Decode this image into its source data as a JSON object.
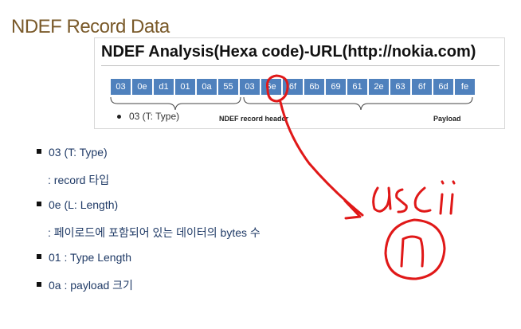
{
  "slide": {
    "title": "NDEF Record Data"
  },
  "panel": {
    "title": "NDEF Analysis(Hexa code)-URL(http://nokia.com)",
    "hex_bytes": [
      "03",
      "0e",
      "d1",
      "01",
      "0a",
      "55",
      "03",
      "6e",
      "6f",
      "6b",
      "69",
      "61",
      "2e",
      "63",
      "6f",
      "6d",
      "fe"
    ],
    "legend": "03 (T: Type)",
    "header_label": "NDEF record header",
    "payload_label": "Payload"
  },
  "bullets": [
    {
      "text": "03 (T: Type)",
      "marker": true
    },
    {
      "text": ": record 타입",
      "marker": false
    },
    {
      "text": "0e (L: Length)",
      "marker": true
    },
    {
      "text": ": 페이로드에 포함되어 있는 데이터의 bytes 수",
      "marker": false
    },
    {
      "text": "01 : Type Length",
      "marker": true
    },
    {
      "text": "0a : payload 크기",
      "marker": true
    }
  ],
  "annotation": {
    "color": "#e02020"
  }
}
